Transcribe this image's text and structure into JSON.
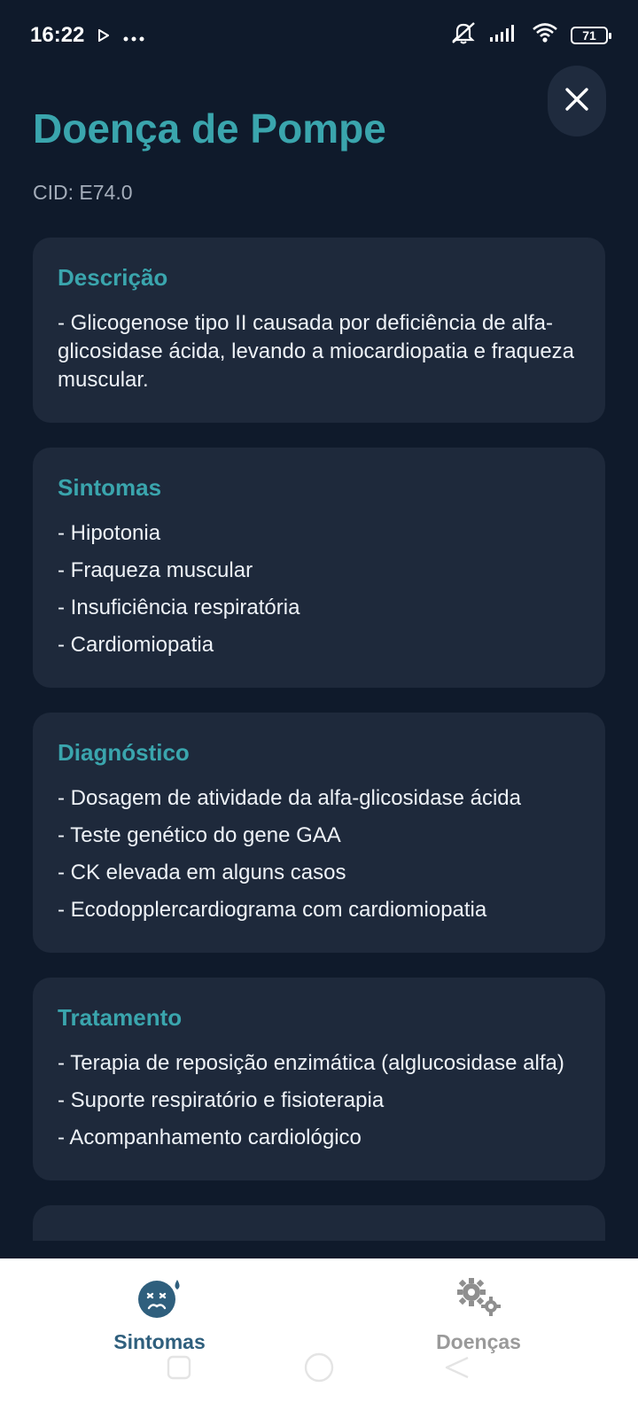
{
  "status_bar": {
    "time": "16:22",
    "battery": "71",
    "icons": [
      "play-icon",
      "more-dots-icon",
      "mute-icon",
      "signal-icon",
      "wifi-icon",
      "battery-icon"
    ]
  },
  "header": {
    "title": "Doença de Pompe",
    "cid": "CID: E74.0",
    "close_icon": "close-icon"
  },
  "sections": {
    "descricao": {
      "heading": "Descrição",
      "items": [
        "- Glicogenose tipo II causada por deficiência de alfa-glicosidase ácida, levando a miocardiopatia e fraqueza muscular."
      ]
    },
    "sintomas": {
      "heading": "Sintomas",
      "items": [
        "- Hipotonia",
        "- Fraqueza muscular",
        "- Insuficiência respiratória",
        "- Cardiomiopatia"
      ]
    },
    "diagnostico": {
      "heading": "Diagnóstico",
      "items": [
        "- Dosagem de atividade da alfa-glicosidase ácida",
        "- Teste genético do gene GAA",
        "- CK elevada em alguns casos",
        "- Ecodopplercardiograma com cardiomiopatia"
      ]
    },
    "tratamento": {
      "heading": "Tratamento",
      "items": [
        "- Terapia de reposição enzimática (alglucosidase alfa)",
        "- Suporte respiratório e fisioterapia",
        "- Acompanhamento cardiológico"
      ]
    }
  },
  "bottom_nav": {
    "sintomas_label": "Sintomas",
    "doencas_label": "Doenças",
    "active": "Sintomas",
    "active_color": "#2f5f7d",
    "inactive_color": "#9a9a9a"
  },
  "colors": {
    "background": "#0f1a2b",
    "card": "#1e293b",
    "accent": "#3aa5ad"
  }
}
